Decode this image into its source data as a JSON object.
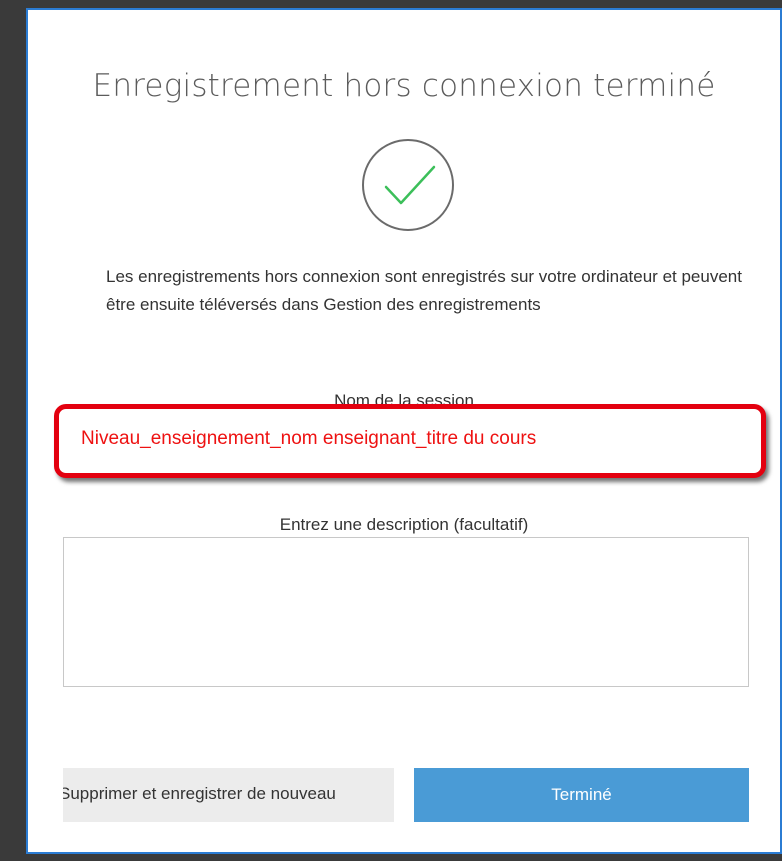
{
  "dialog": {
    "title": "Enregistrement hors connexion terminé",
    "status_icon": "checkmark-circle-icon",
    "info_text": "Les enregistrements hors connexion sont enregistrés sur votre ordinateur et peuvent être ensuite téléversés dans Gestion des enregistrements",
    "session": {
      "label": "Nom de la session",
      "value": "Niveau_enseignement_nom enseignant_titre du cours"
    },
    "description": {
      "label": "Entrez une description (facultatif)",
      "value": ""
    },
    "buttons": {
      "delete_label": "Supprimer et enregistrer de nouveau",
      "done_label": "Terminé"
    }
  },
  "colors": {
    "accent": "#2b7cd3",
    "done_button": "#4a9bd6",
    "check": "#3cbf5a",
    "highlight": "#e3000f"
  }
}
